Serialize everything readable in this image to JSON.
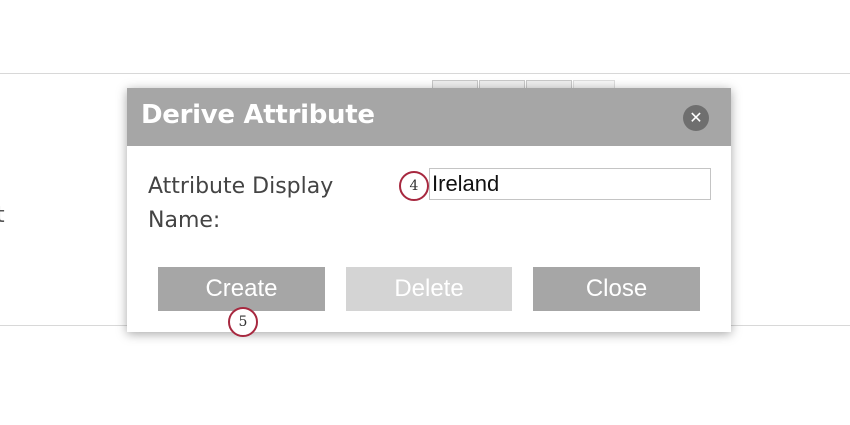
{
  "background": {
    "fragment_text": "t"
  },
  "dialog": {
    "title": "Derive Attribute",
    "close_icon": "close-x-icon",
    "field_label": "Attribute Display Name:",
    "field_value": "Ireland",
    "buttons": {
      "create": "Create",
      "delete": "Delete",
      "close": "Close"
    }
  },
  "markers": {
    "step4": "4",
    "step5": "5"
  },
  "colors": {
    "header_bg": "#a6a6a6",
    "button_bg": "#a6a6a6",
    "button_disabled_bg": "#d4d4d4",
    "marker_border": "#a7283f",
    "close_icon_bg": "#6f6f6f"
  }
}
